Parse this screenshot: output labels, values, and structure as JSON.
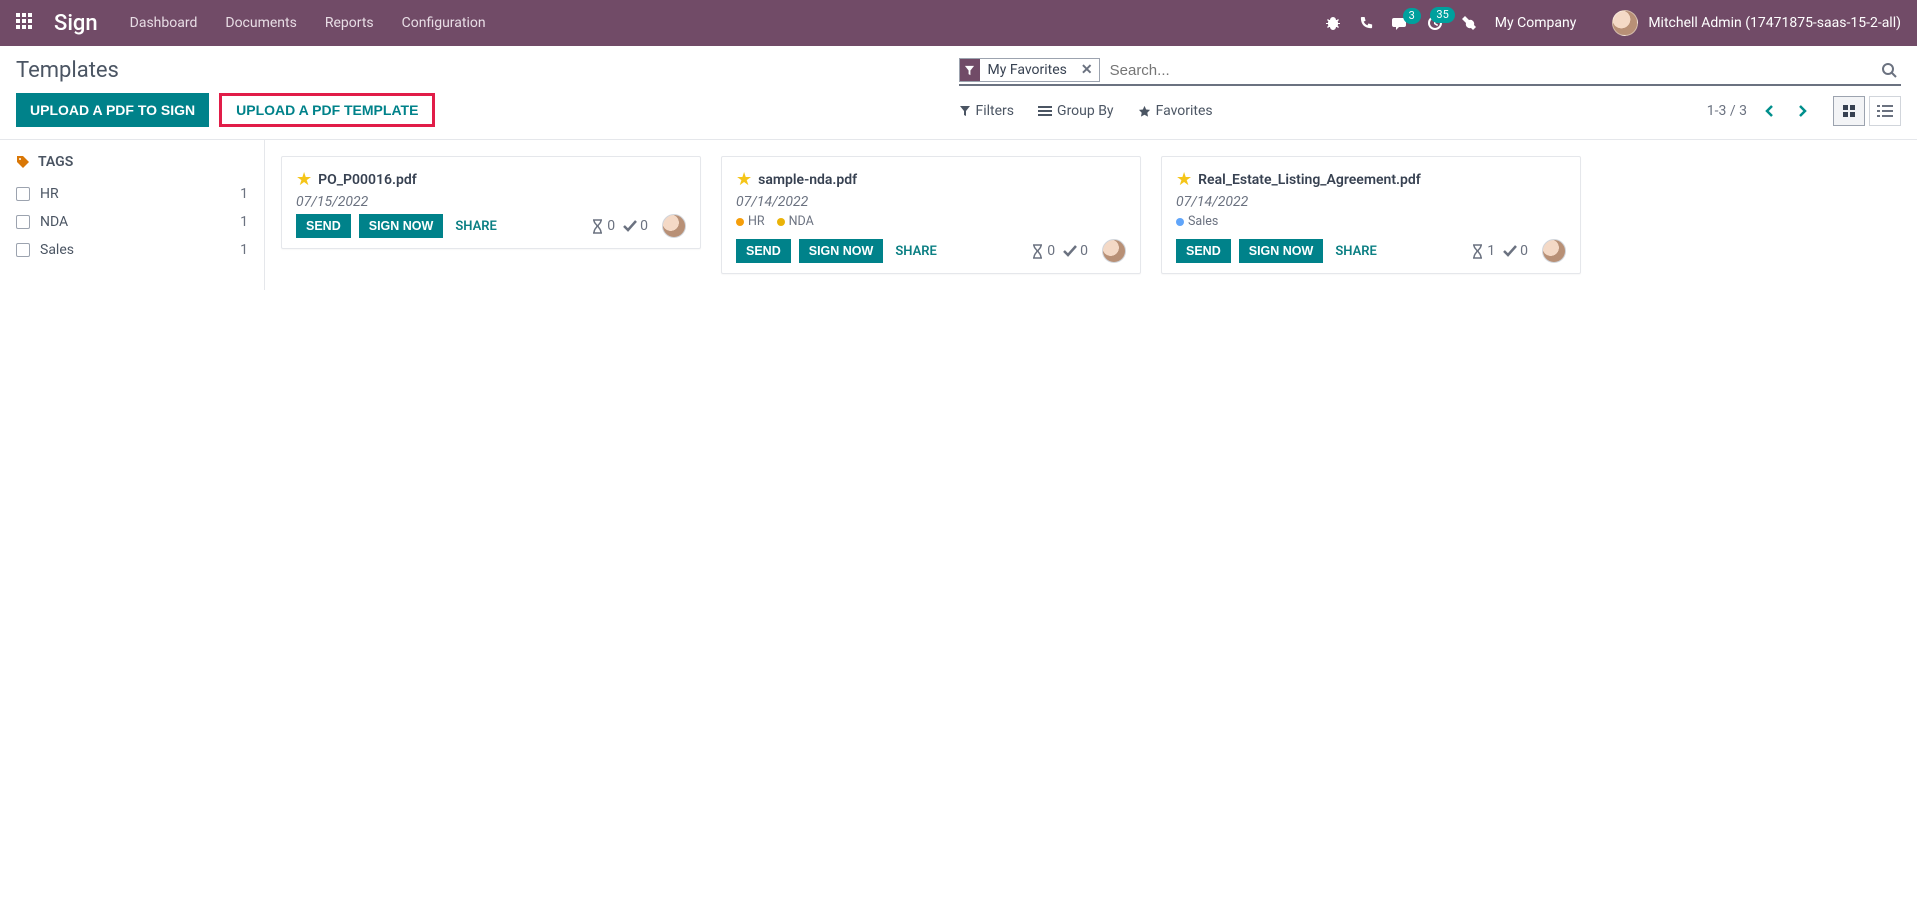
{
  "topnav": {
    "brand": "Sign",
    "menu": [
      "Dashboard",
      "Documents",
      "Reports",
      "Configuration"
    ],
    "chat_badge": "3",
    "clock_badge": "35",
    "company": "My Company",
    "user": "Mitchell Admin (17471875-saas-15-2-all)"
  },
  "page": {
    "title": "Templates",
    "upload_sign": "Upload a PDF to Sign",
    "upload_template": "Upload a PDF Template"
  },
  "search": {
    "facet_label": "My Favorites",
    "placeholder": "Search..."
  },
  "filters": {
    "filters_label": "Filters",
    "groupby_label": "Group By",
    "favorites_label": "Favorites",
    "pager": "1-3 / 3"
  },
  "sidebar": {
    "header": "TAGS",
    "tags": [
      {
        "label": "HR",
        "count": "1"
      },
      {
        "label": "NDA",
        "count": "1"
      },
      {
        "label": "Sales",
        "count": "1"
      }
    ]
  },
  "card_buttons": {
    "send": "Send",
    "sign_now": "Sign Now",
    "share": "Share"
  },
  "cards": [
    {
      "title": "PO_P00016.pdf",
      "date": "07/15/2022",
      "tags": [],
      "pending": "0",
      "done": "0"
    },
    {
      "title": "sample-nda.pdf",
      "date": "07/14/2022",
      "tags": [
        {
          "label": "HR",
          "color": "#f59e0b"
        },
        {
          "label": "NDA",
          "color": "#eab308"
        }
      ],
      "pending": "0",
      "done": "0"
    },
    {
      "title": "Real_Estate_Listing_Agreement.pdf",
      "date": "07/14/2022",
      "tags": [
        {
          "label": "Sales",
          "color": "#60a5fa"
        }
      ],
      "pending": "1",
      "done": "0"
    }
  ]
}
